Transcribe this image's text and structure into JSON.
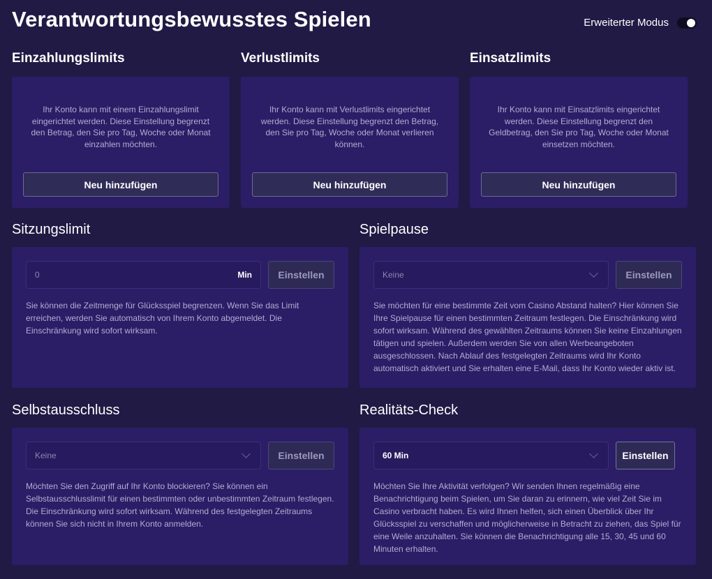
{
  "header": {
    "title": "Verantwortungsbewusstes Spielen",
    "mode_label": "Erweiterter Modus",
    "mode_enabled": true
  },
  "limits": [
    {
      "title": "Einzahlungslimits",
      "description": "Ihr Konto kann mit einem Einzahlungslimit eingerichtet werden. Diese Einstellung begrenzt den Betrag, den Sie pro Tag, Woche oder Monat einzahlen möchten.",
      "button": "Neu hinzufügen"
    },
    {
      "title": "Verlustlimits",
      "description": "Ihr Konto kann mit Verlustlimits eingerichtet werden. Diese Einstellung begrenzt den Betrag, den Sie pro Tag, Woche oder Monat verlieren können.",
      "button": "Neu hinzufügen"
    },
    {
      "title": "Einsatzlimits",
      "description": "Ihr Konto kann mit Einsatzlimits eingerichtet werden. Diese Einstellung begrenzt den Geldbetrag, den Sie pro Tag, Woche oder Monat einsetzen möchten.",
      "button": "Neu hinzufügen"
    }
  ],
  "session_limit": {
    "title": "Sitzungslimit",
    "input_value": "0",
    "suffix": "Min",
    "button": "Einstellen",
    "description": "Sie können die Zeitmenge für Glücksspiel begrenzen. Wenn Sie das Limit erreichen, werden Sie automatisch von Ihrem Konto abgemeldet. Die Einschränkung wird sofort wirksam."
  },
  "game_pause": {
    "title": "Spielpause",
    "selected": "Keine",
    "button": "Einstellen",
    "description": "Sie möchten für eine bestimmte Zeit vom Casino Abstand halten? Hier können Sie Ihre Spielpause für einen bestimmten Zeitraum festlegen. Die Einschränkung wird sofort wirksam. Während des gewählten Zeitraums können Sie keine Einzahlungen tätigen und spielen. Außerdem werden Sie von allen Werbeangeboten ausgeschlossen. Nach Ablauf des festgelegten Zeitraums wird Ihr Konto automatisch aktiviert und Sie erhalten eine E-Mail, dass Ihr Konto wieder aktiv ist."
  },
  "self_exclusion": {
    "title": "Selbstausschluss",
    "selected": "Keine",
    "button": "Einstellen",
    "description": "Möchten Sie den Zugriff auf Ihr Konto blockieren? Sie können ein Selbstausschlusslimit für einen bestimmten oder unbestimmten Zeitraum festlegen. Die Einschränkung wird sofort wirksam. Während des festgelegten Zeitraums können Sie sich nicht in Ihrem Konto anmelden."
  },
  "reality_check": {
    "title": "Realitäts-Check",
    "selected": "60 Min",
    "button": "Einstellen",
    "description": "Möchten Sie Ihre Aktivität verfolgen? Wir senden Ihnen regelmäßig eine Benachrichtigung beim Spielen, um Sie daran zu erinnern, wie viel Zeit Sie im Casino verbracht haben. Es wird Ihnen helfen, sich einen Überblick über Ihr Glücksspiel zu verschaffen und möglicherweise in Betracht zu ziehen, das Spiel für eine Weile anzuhalten. Sie können die Benachrichtigung alle 15, 30, 45 und 60 Minuten erhalten."
  }
}
